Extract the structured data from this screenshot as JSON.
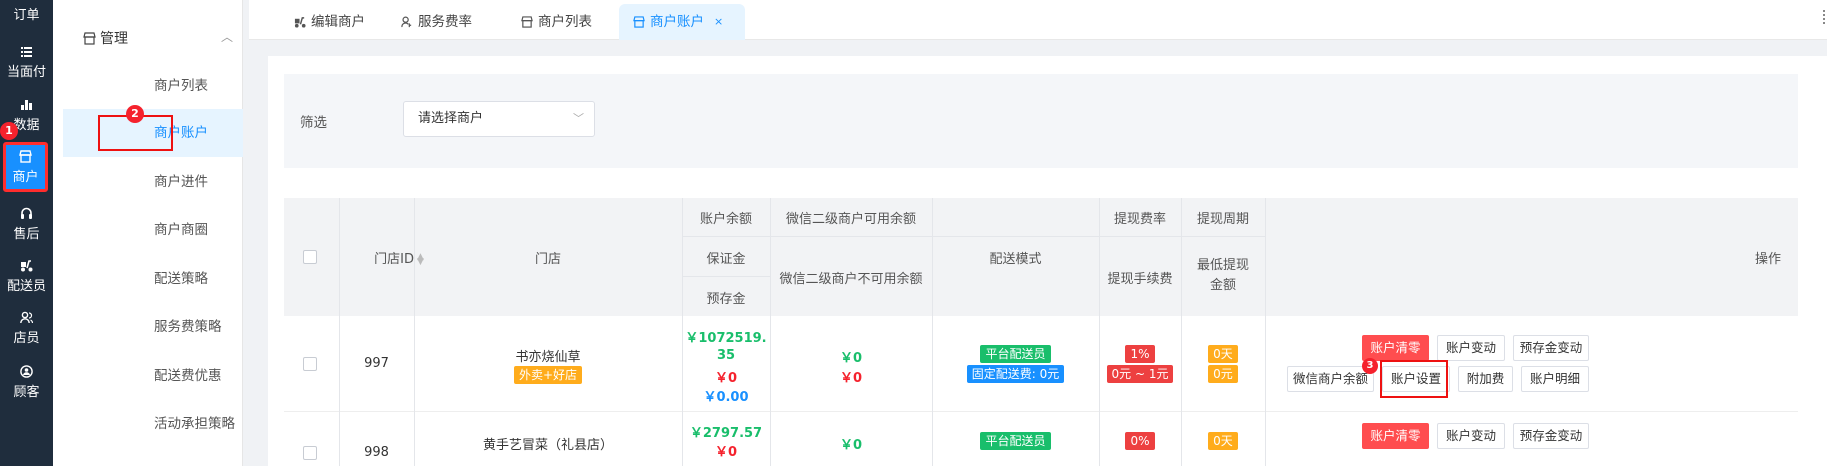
{
  "rail": {
    "items": [
      {
        "label": "订单",
        "icon": "order-icon"
      },
      {
        "label": "当面付",
        "icon": "list-icon"
      },
      {
        "label": "数据",
        "icon": "bar-chart-icon"
      },
      {
        "label": "商户",
        "icon": "store-icon"
      },
      {
        "label": "售后",
        "icon": "headset-icon"
      },
      {
        "label": "配送员",
        "icon": "scooter-icon"
      },
      {
        "label": "店员",
        "icon": "users-icon"
      },
      {
        "label": "顾客",
        "icon": "customer-icon"
      }
    ],
    "active_index": 3,
    "badge": "1"
  },
  "submenu": {
    "group": "管理",
    "items": [
      "商户列表",
      "商户账户",
      "商户进件",
      "商户商圈",
      "配送策略",
      "服务费策略",
      "配送费优惠",
      "活动承担策略"
    ],
    "active_index": 1,
    "badge": "2"
  },
  "tabs": [
    {
      "label": "编辑商户",
      "icon": "truck-icon"
    },
    {
      "label": "服务费率",
      "icon": "user-key-icon"
    },
    {
      "label": "商户列表",
      "icon": "store-icon"
    },
    {
      "label": "商户账户",
      "icon": "store-icon",
      "active": true,
      "close": "×"
    }
  ],
  "filter": {
    "label": "筛选",
    "select_value": "请选择商户"
  },
  "table": {
    "headers": {
      "store_id": "门店ID",
      "store": "门店",
      "balance": "账户余额",
      "deposit": "保证金",
      "prestore": "预存金",
      "wx_available": "微信二级商户可用余额",
      "wx_unavailable": "微信二级商户不可用余额",
      "delivery_mode": "配送模式",
      "withdraw_rate": "提现费率",
      "withdraw_fee": "提现手续费",
      "withdraw_cycle": "提现周期",
      "min_withdraw": "最低提现金额",
      "ops": "操作"
    },
    "rows": [
      {
        "id": "997",
        "store": "书亦烧仙草",
        "store_tag": "外卖+好店",
        "balance_l1": "￥1072519.",
        "balance_l2": "35",
        "deposit": "￥0",
        "prestore": "￥0.00",
        "wx_available": "￥0",
        "wx_unavailable": "￥0",
        "delivery_tag": "平台配送员",
        "delivery_fee_tag": "固定配送费: 0元",
        "rate": "1%",
        "fee": "0元 ~ 1元",
        "cycle": "0天",
        "min": "0元"
      },
      {
        "id": "998",
        "store": "黄手艺冒菜（礼县店）",
        "balance_l1": "￥2797.57",
        "deposit": "￥0",
        "wx_available": "￥0",
        "delivery_tag": "平台配送员",
        "rate": "0%",
        "cycle": "0天"
      }
    ],
    "buttons": {
      "clear": "账户清零",
      "change": "账户变动",
      "prestore_change": "预存金变动",
      "wx_balance": "微信商户余额",
      "settings": "账户设置",
      "surcharge": "附加费",
      "detail": "账户明细"
    },
    "settings_badge": "3"
  },
  "colors": {
    "rail_bg": "#1f2d3d",
    "accent": "#1890ff",
    "danger": "#ff4d4f",
    "success": "#19be6b",
    "warning": "#ffac1c"
  }
}
